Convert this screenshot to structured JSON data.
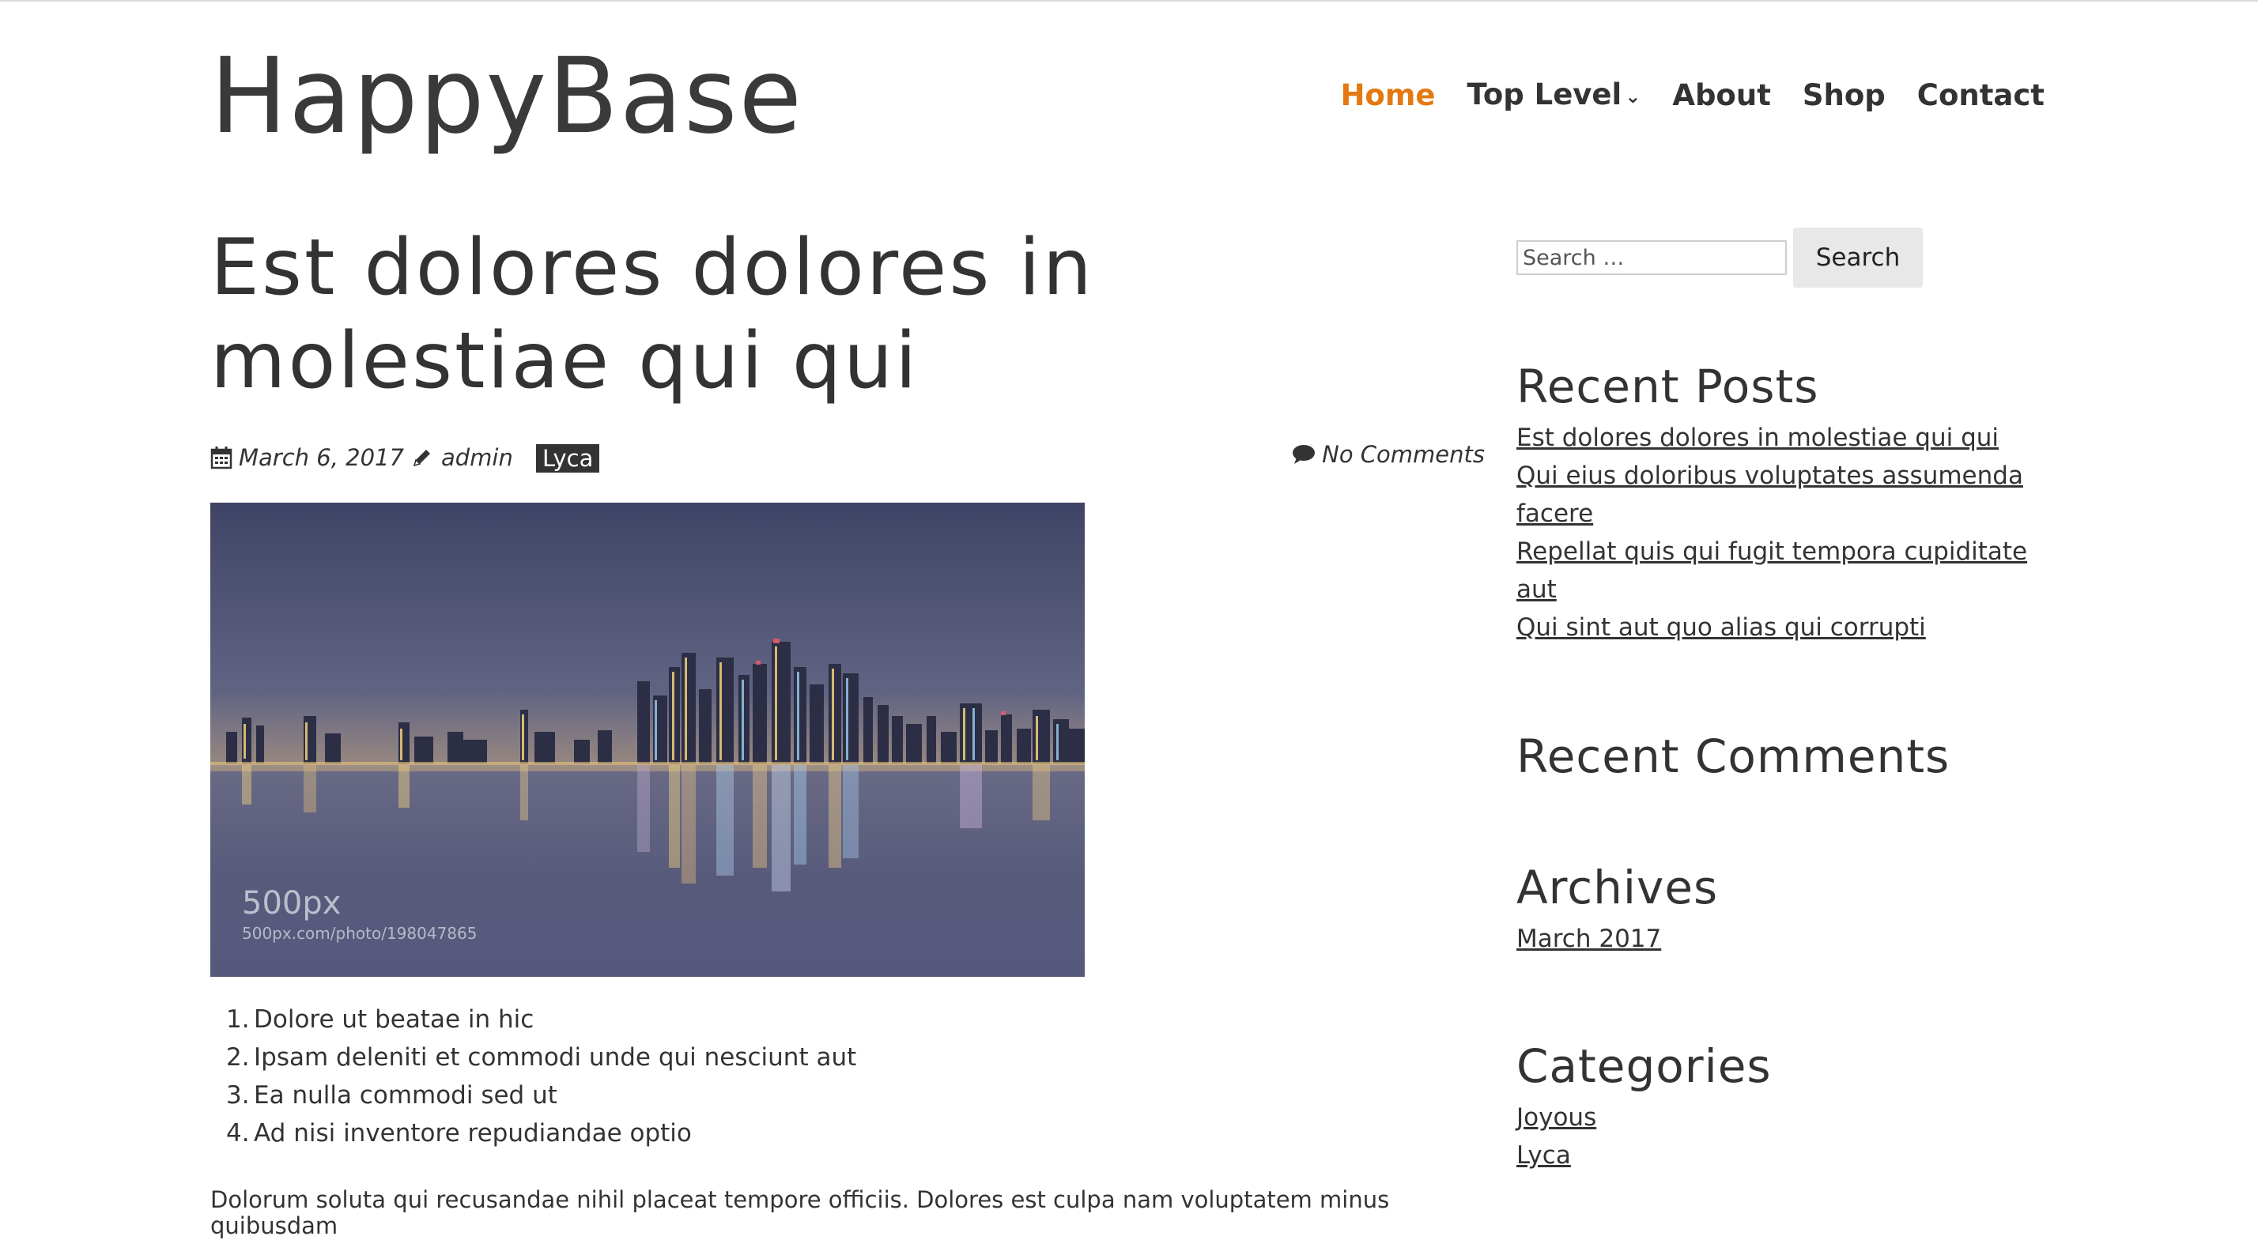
{
  "site": {
    "title": "HappyBase"
  },
  "nav": {
    "items": [
      {
        "label": "Home",
        "active": true
      },
      {
        "label": "Top Level",
        "dropdown": true
      },
      {
        "label": "About"
      },
      {
        "label": "Shop"
      },
      {
        "label": "Contact"
      }
    ],
    "active_color": "#e47911"
  },
  "post": {
    "title": "Est dolores dolores in molestiae qui qui",
    "date": "March 6, 2017",
    "author": "admin",
    "category": "Lyca",
    "comments": "No Comments",
    "image": {
      "watermark_brand": "500px",
      "watermark_url": "500px.com/photo/198047865"
    },
    "list": [
      "Dolore ut beatae in hic",
      "Ipsam deleniti et commodi unde qui nesciunt aut",
      "Ea nulla commodi sed ut",
      "Ad nisi inventore repudiandae optio"
    ],
    "paragraph": "Dolorum soluta qui recusandae nihil placeat tempore officiis. Dolores est culpa nam voluptatem minus quibusdam"
  },
  "sidebar": {
    "search": {
      "placeholder": "Search …",
      "button": "Search"
    },
    "recent_posts": {
      "title": "Recent Posts",
      "items": [
        "Est dolores dolores in molestiae qui qui",
        "Qui eius doloribus voluptates assumenda facere",
        "Repellat quis qui fugit tempora cupiditate aut",
        "Qui sint aut quo alias qui corrupti"
      ]
    },
    "recent_comments": {
      "title": "Recent Comments"
    },
    "archives": {
      "title": "Archives",
      "items": [
        "March 2017"
      ]
    },
    "categories": {
      "title": "Categories",
      "items": [
        "Joyous",
        "Lyca"
      ]
    }
  },
  "icons": {
    "date": "calendar-icon",
    "author": "pencil-icon",
    "comments": "comment-icon",
    "dropdown": "chevron-down-icon"
  }
}
